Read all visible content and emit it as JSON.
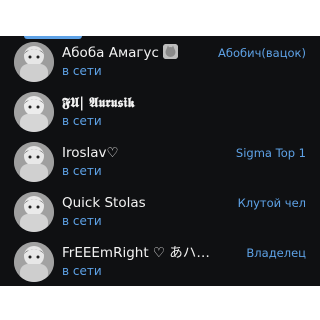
{
  "members": [
    {
      "name": "Абоба Амагус",
      "has_emoji": true,
      "status": "в сети",
      "role": "Абобич(вацок)"
    },
    {
      "name": "𝕱𝖀| 𝕬𝖚𝖗𝖚𝖘𝖎𝖐",
      "status": "в сети",
      "role": ""
    },
    {
      "name": "Iroslav♡",
      "status": "в сети",
      "role": "Sigma Top 1"
    },
    {
      "name": "Quick Stolas",
      "status": "в сети",
      "role": "Клутой чел"
    },
    {
      "name": "FrEEEmRight ♡ あハナマサ…",
      "status": "в сети",
      "role": "Владелец"
    }
  ]
}
